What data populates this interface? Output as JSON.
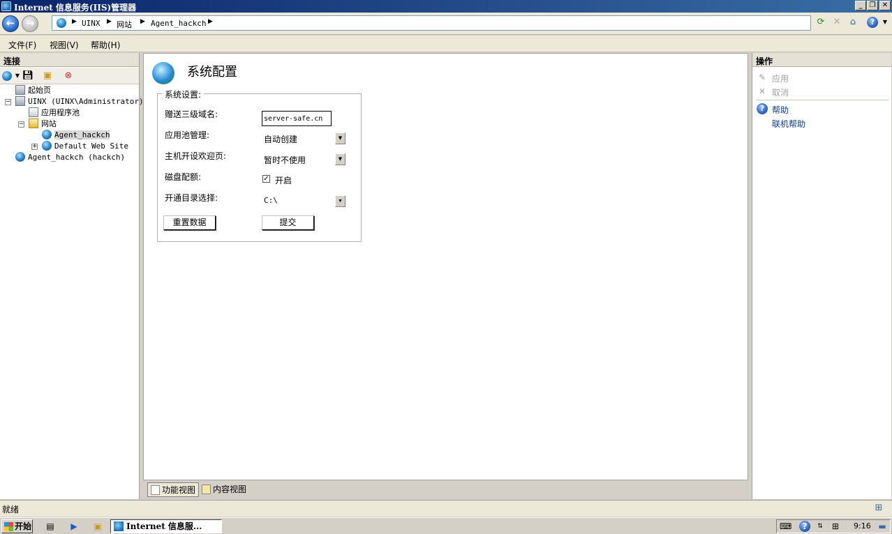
{
  "window": {
    "title": "Internet 信息服务(IIS)管理器"
  },
  "address": {
    "crumbs": [
      "UINX",
      "网站",
      "Agent_hackch"
    ]
  },
  "menu": {
    "items": [
      "文件(F)",
      "视图(V)",
      "帮助(H)"
    ]
  },
  "connections": {
    "header": "连接",
    "tree": [
      {
        "label": "起始页"
      },
      {
        "label": "UINX (UINX\\Administrator)"
      },
      {
        "label": "应用程序池"
      },
      {
        "label": "网站"
      },
      {
        "label": "Agent_hackch"
      },
      {
        "label": "Default Web Site"
      },
      {
        "label": "Agent_hackch (hackch)"
      }
    ]
  },
  "main": {
    "title": "系统配置",
    "group_label": "系统设置:",
    "fields": {
      "domain_label": "赠送三级域名:",
      "domain_value": "server-safe.cn",
      "pool_label": "应用池管理:",
      "pool_value": "自动创建",
      "welcome_label": "主机开设欢迎页:",
      "welcome_value": "暂时不使用",
      "quota_label": "磁盘配额:",
      "quota_checked": true,
      "quota_option": "开启",
      "dir_label": "开通目录选择:",
      "dir_value": "C:\\"
    },
    "buttons": {
      "reset": "重置数据",
      "submit": "提交"
    }
  },
  "view_tabs": {
    "features": "功能视图",
    "content": "内容视图"
  },
  "actions": {
    "header": "操作",
    "items": [
      {
        "label": "应用",
        "enabled": false
      },
      {
        "label": "取消",
        "enabled": false
      },
      {
        "label": "帮助",
        "enabled": true
      },
      {
        "label": "联机帮助",
        "enabled": true
      }
    ]
  },
  "status": {
    "text": "就绪"
  },
  "taskbar": {
    "start": "开始",
    "task": "Internet 信息服...",
    "clock": "9:16"
  }
}
